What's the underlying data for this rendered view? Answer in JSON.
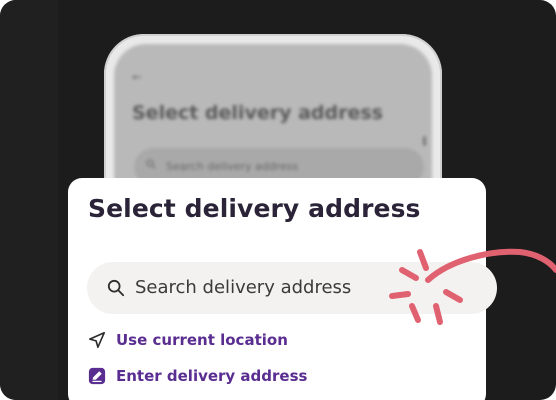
{
  "background_phone": {
    "back_icon": "back-arrow-icon",
    "title": "Select delivery address",
    "search_placeholder": "Search delivery address"
  },
  "card": {
    "title": "Select delivery address",
    "search": {
      "icon": "search-icon",
      "placeholder": "Search delivery address"
    },
    "options": [
      {
        "icon": "location-arrow-icon",
        "label": "Use current location"
      },
      {
        "icon": "edit-address-icon",
        "label": "Enter delivery address"
      }
    ]
  },
  "colors": {
    "frame_bg": "#1c1c1c",
    "title_text": "#2b2438",
    "accent_purple": "#5a2d91",
    "doodle_pink": "#e0616f",
    "search_bg": "#f3f2f1"
  }
}
